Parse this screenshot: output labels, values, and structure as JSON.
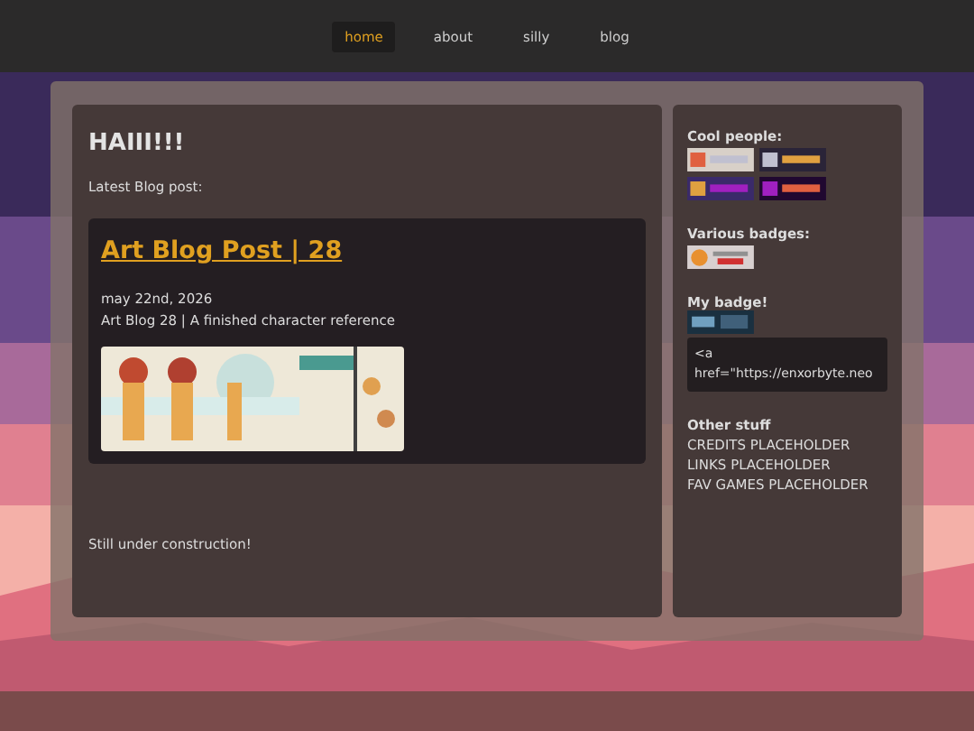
{
  "nav": [
    {
      "label": "home",
      "selected": true
    },
    {
      "label": "about",
      "selected": false
    },
    {
      "label": "silly",
      "selected": false
    },
    {
      "label": "blog",
      "selected": false
    }
  ],
  "main": {
    "heading": "HAIII!!!",
    "intro": "Latest Blog post:",
    "post": {
      "title": "Art Blog Post | 28",
      "date": "may 22nd, 2026",
      "summary": "Art Blog 28 | A finished character reference",
      "image": {
        "kind": "picture"
      }
    },
    "footer": "Still under construction!"
  },
  "sidebar": {
    "cool_people": {
      "title": "Cool people:",
      "badges": [
        {
          "kind": "picture"
        },
        {
          "kind": "picture"
        },
        {
          "kind": "picture"
        },
        {
          "kind": "picture"
        }
      ]
    },
    "various_badges": {
      "title": "Various badges:",
      "badges": [
        {
          "kind": "picture"
        }
      ]
    },
    "my_badge": {
      "title": "My badge!",
      "badge": {
        "kind": "picture"
      },
      "code_lines": [
        "<a",
        "href=\"https://enxorbyte.neo"
      ]
    },
    "other_stuff": {
      "title": "Other stuff",
      "links": [
        "CREDITS PLACEHOLDER",
        "LINKS PLACEHOLDER",
        "FAV GAMES PLACEHOLDER"
      ]
    }
  }
}
